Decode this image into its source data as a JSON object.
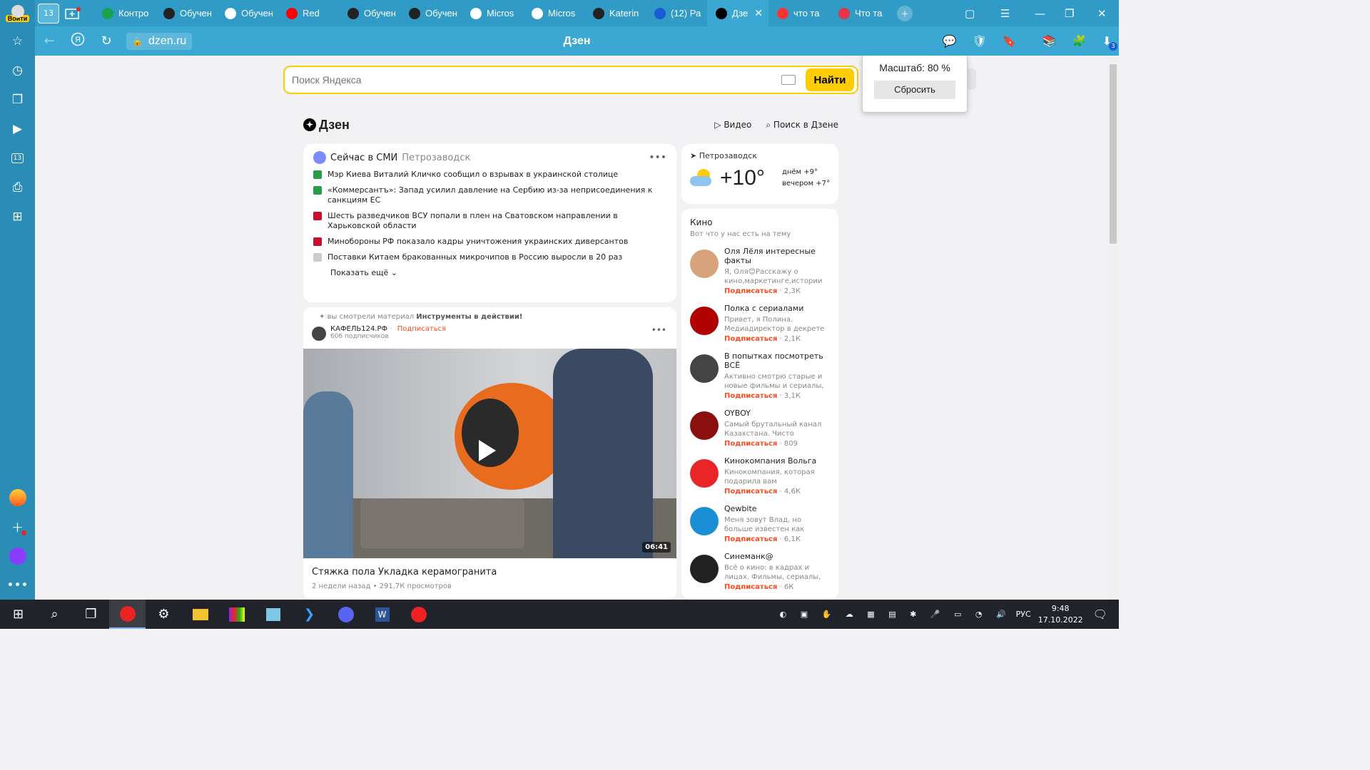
{
  "tabbar": {
    "profile_label": "Войти",
    "tab_count": "13",
    "tabs": [
      {
        "label": "Контро",
        "icon": "checkmark-icon",
        "color": "#1aa34a"
      },
      {
        "label": "Обучен",
        "icon": "openai-icon",
        "color": "#222222"
      },
      {
        "label": "Обучен",
        "icon": "document-icon",
        "color": "#ffffff"
      },
      {
        "label": "Red",
        "icon": "youtube-icon",
        "color": "#ff0000"
      },
      {
        "label": "Обучен",
        "icon": "openai-icon",
        "color": "#222222"
      },
      {
        "label": "Обучен",
        "icon": "openai-icon",
        "color": "#222222"
      },
      {
        "label": "Micros",
        "icon": "document-icon",
        "color": "#ffffff"
      },
      {
        "label": "Micros",
        "icon": "document-icon",
        "color": "#ffffff"
      },
      {
        "label": "Katerin",
        "icon": "github-icon",
        "color": "#222222"
      },
      {
        "label": "(12) Ра",
        "icon": "mail-icon",
        "color": "#1a5bd6"
      },
      {
        "label": "Дзе",
        "icon": "dzen-icon",
        "color": "#000000"
      },
      {
        "label": "что та",
        "icon": "yandex-icon",
        "color": "#ff3333"
      },
      {
        "label": "Что та",
        "icon": "number-two-icon",
        "color": "#e8344a"
      }
    ]
  },
  "addressbar": {
    "url": "dzen.ru",
    "title": "Дзен",
    "downloads_count": "3"
  },
  "search": {
    "placeholder": "Поиск Яндекса",
    "button": "Найти"
  },
  "zoom_popup": {
    "label": "Масштаб: 80 %",
    "reset": "Сбросить"
  },
  "dzen_header": {
    "logo": "Дзен",
    "video": "Видео",
    "search": "Поиск в Дзене"
  },
  "smi": {
    "title": "Сейчас в СМИ",
    "city": "Петрозаводск",
    "items": [
      {
        "text": "Мэр Киева Виталий Кличко сообщил о взрывах в украинской столице",
        "color": "#2a9d4a"
      },
      {
        "text": "«Коммерсантъ»: Запад усилил давление на Сербию из-за неприсоединения к санкциям ЕС",
        "color": "#2a9d4a"
      },
      {
        "text": "Шесть разведчиков ВСУ попали в плен на Сватовском направлении в Харьковской области",
        "color": "#c8102e"
      },
      {
        "text": "Минобороны РФ показало кадры уничтожения украинских диверсантов",
        "color": "#c8102e"
      },
      {
        "text": "Поставки Китаем бракованных микрочипов в Россию выросли в 20 раз",
        "color": "#cccccc"
      }
    ],
    "more": "Показать ещё"
  },
  "weather": {
    "city": "Петрозаводск",
    "temp": "+10°",
    "day": "днём +9°",
    "evening": "вечером +7°"
  },
  "kino": {
    "title": "Кино",
    "subtitle": "Вот что у нас есть на тему",
    "subscribe": "Подписаться",
    "channels": [
      {
        "name": "Оля Лёля интересные факты",
        "desc": "Я, Оля😊Расскажу о кино,маркетинге,истории🎬...",
        "count": "2,3К",
        "color": "#d8a27a"
      },
      {
        "name": "Полка с сериалами",
        "desc": "Привет, я Полина. Медиадиректор в декрете и...",
        "count": "2,1К",
        "color": "#b00000"
      },
      {
        "name": "В попытках посмотреть ВСЁ",
        "desc": "Активно смотрю старые и новые фильмы и сериалы, и...",
        "count": "3,1К",
        "color": "#444444"
      },
      {
        "name": "OYBOY",
        "desc": "Самый брутальный канал Казахстана. Чисто мужской...",
        "count": "809",
        "color": "#8a1010"
      },
      {
        "name": "Кинокомпания Вольга",
        "desc": "Кинокомпания, которая подарила вам «Миллионера...",
        "count": "4,6К",
        "color": "#e8262a"
      },
      {
        "name": "Qewbite",
        "desc": "Меня зовут Влад, но больше известен как Кьюбайт! На...",
        "count": "6,1К",
        "color": "#1a8fd6"
      },
      {
        "name": "Синеманк@",
        "desc": "Всё о кино: в кадрах и лицах. Фильмы, сериалы, актёры,...",
        "count": "6К",
        "color": "#222222"
      }
    ]
  },
  "post": {
    "context_prefix": "вы смотрели материал",
    "context_title": "Инструменты в действии!",
    "author": "КАФЕЛЬ124.РФ",
    "subscribe": "Подписаться",
    "subscribers": "606 подписчиков",
    "duration": "06:41",
    "title": "Стяжка пола Укладка керамогранита",
    "meta": "2 недели назад • 291,7К просмотров"
  },
  "taskbar": {
    "lang": "РУС",
    "time": "9:48",
    "date": "17.10.2022"
  }
}
